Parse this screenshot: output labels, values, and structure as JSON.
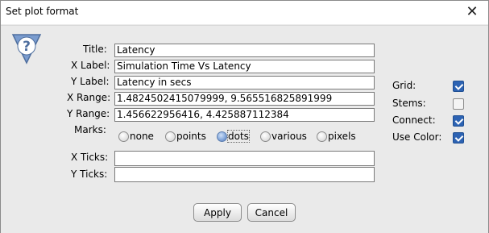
{
  "window": {
    "title": "Set plot format",
    "close_glyph": "✕"
  },
  "form": {
    "title_label": "Title:",
    "title_value": "Latency",
    "xlabel_label": "X Label:",
    "xlabel_value": "Simulation Time Vs Latency",
    "ylabel_label": "Y Label:",
    "ylabel_value": "Latency in secs",
    "xrange_label": "X Range:",
    "xrange_value": "1.4824502415079999, 9.565516825891999",
    "yrange_label": "Y Range:",
    "yrange_value": "1.456622956416, 4.425887112384",
    "marks_label": "Marks:",
    "marks_options": [
      "none",
      "points",
      "dots",
      "various",
      "pixels"
    ],
    "marks_selected": "dots",
    "xticks_label": "X Ticks:",
    "xticks_value": "",
    "yticks_label": "Y Ticks:",
    "yticks_value": ""
  },
  "options": {
    "grid_label": "Grid:",
    "grid_checked": true,
    "stems_label": "Stems:",
    "stems_checked": false,
    "connect_label": "Connect:",
    "connect_checked": true,
    "use_color_label": "Use Color:",
    "use_color_checked": true
  },
  "buttons": {
    "apply_label": "Apply",
    "cancel_label": "Cancel"
  },
  "icons": {
    "help": "help-question-icon",
    "close": "close-icon"
  },
  "colors": {
    "checkbox_accent": "#2d63b3",
    "radio_selected": "#6f94cf",
    "help_icon": "#6d8fc2"
  }
}
